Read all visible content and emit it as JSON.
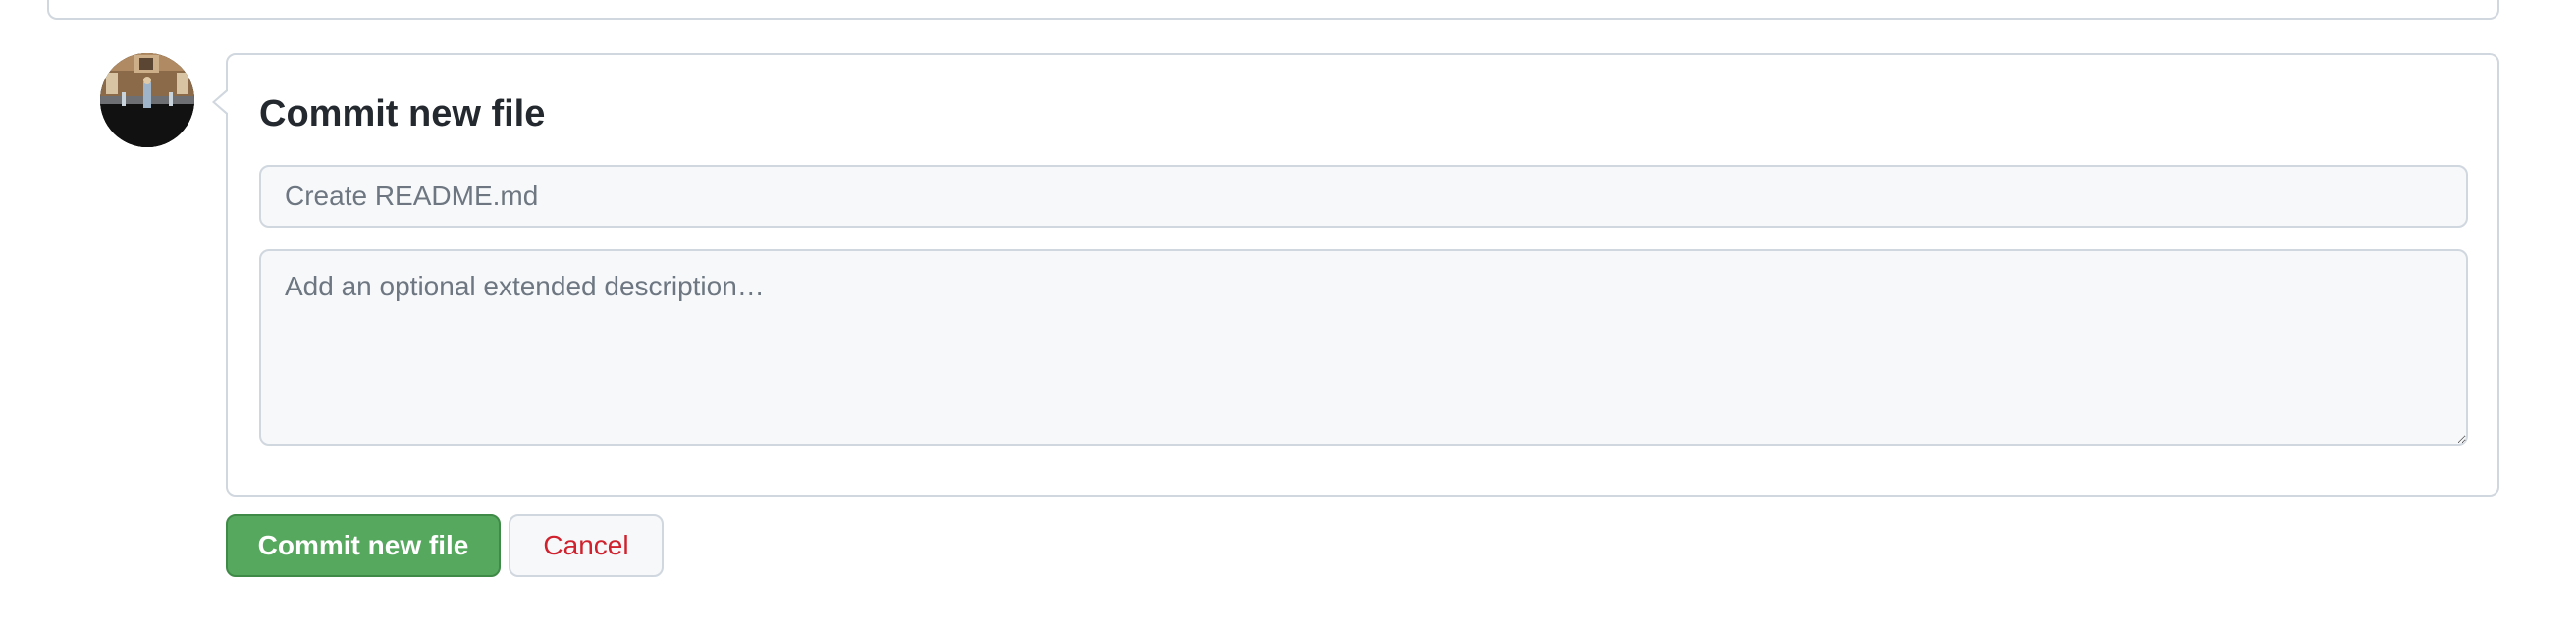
{
  "commit": {
    "title": "Commit new file",
    "summary_placeholder": "Create README.md",
    "summary_value": "",
    "description_placeholder": "Add an optional extended description…",
    "description_value": ""
  },
  "actions": {
    "commit_label": "Commit new file",
    "cancel_label": "Cancel"
  },
  "colors": {
    "primary_button": "#57a85f",
    "cancel_text": "#cf222e",
    "border": "#d0d7de",
    "input_bg": "#f6f8fa"
  },
  "icons": {
    "avatar": "user-avatar-photo",
    "resize_handle": "textarea-resize-grip"
  }
}
